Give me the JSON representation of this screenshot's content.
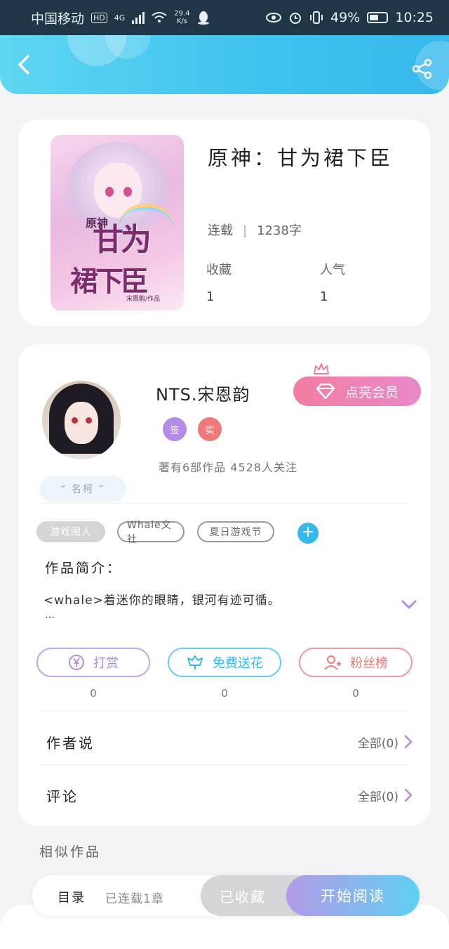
{
  "status_bar": {
    "carrier": "中国移动",
    "hd": "HD",
    "network": "4G",
    "speed_value": "29.4",
    "speed_unit": "K/s",
    "battery": "49%",
    "time": "10:25"
  },
  "book": {
    "title": "原神：甘为裙下臣",
    "status": "连载",
    "word_count": "1238字",
    "favorites_label": "收藏",
    "favorites_value": "1",
    "popularity_label": "人气",
    "popularity_value": "1",
    "cover": {
      "small_title": "原神",
      "title_line1": "甘为",
      "title_line2": "裙下臣",
      "author_credit": "宋恩韵/作品"
    }
  },
  "author": {
    "name": "NTS.宋恩韵",
    "badge_sign": "签",
    "badge_real": "实",
    "stats": "著有6部作品 4528人关注",
    "name_tag": "“ 名柯 ”",
    "vip_button": "点亮会员"
  },
  "tags": [
    "游戏闺人",
    "Whale文社",
    "夏日游戏节"
  ],
  "intro": {
    "title": "作品简介：",
    "text": "<whale>着迷你的眼睛，银河有迹可循。",
    "more": "…"
  },
  "actions": {
    "tip_label": "打赏",
    "tip_count": "0",
    "flower_label": "免费送花",
    "flower_count": "0",
    "fans_label": "粉丝榜",
    "fans_count": "0"
  },
  "rows": {
    "author_says_label": "作者说",
    "author_says_right": "全部(0)",
    "comments_label": "评论",
    "comments_right": "全部(0)"
  },
  "similar_title": "相似作品",
  "bottom_bar": {
    "toc": "目录",
    "chapters": "已连载1章",
    "collected": "已收藏",
    "start_reading": "开始阅读"
  },
  "colors": {
    "accent_blue": "#36b8ec",
    "purple": "#b48be6",
    "red": "#ef7878"
  }
}
